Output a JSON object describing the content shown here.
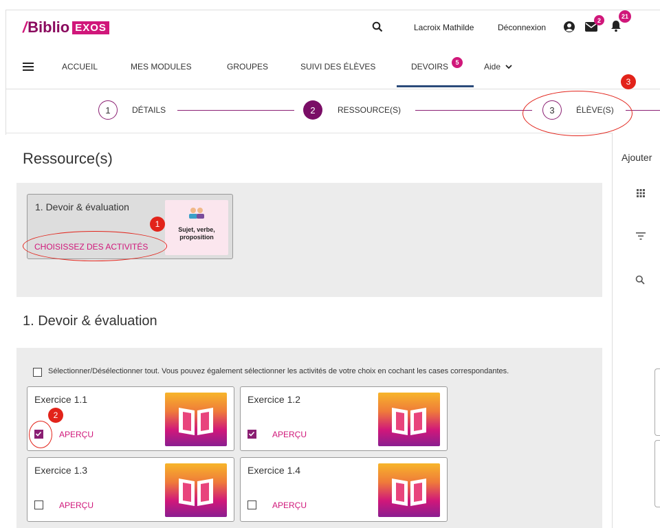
{
  "header": {
    "logo_prefix": "Biblio",
    "logo_suffix": "EXOS",
    "user_name": "Lacroix Mathilde",
    "logout_label": "Déconnexion",
    "mail_badge": "2",
    "notif_badge": "21"
  },
  "nav": {
    "items": [
      "ACCUEIL",
      "MES MODULES",
      "GROUPES",
      "SUIVI DES ÉLÈVES",
      "DEVOIRS",
      "Aide"
    ],
    "devoirs_badge": "5"
  },
  "stepper": {
    "steps": [
      {
        "number": "1",
        "label": "DÉTAILS"
      },
      {
        "number": "2",
        "label": "RESSOURCE(S)"
      },
      {
        "number": "3",
        "label": "ÉLÈVE(S)"
      }
    ]
  },
  "right_panel": {
    "title": "Ajouter"
  },
  "resources": {
    "title": "Ressource(s)",
    "card_title": "1. Devoir & évaluation",
    "choose_label": "CHOISISSEZ DES ACTIVITÉS",
    "thumb_text": "Sujet, verbe, proposition"
  },
  "section": {
    "title": "1. Devoir & évaluation",
    "select_all_label": "Sélectionner/Désélectionner tout. Vous pouvez également sélectionner les activités de votre choix en cochant les cases correspondantes.",
    "exercises": [
      {
        "title": "Exercice 1.1",
        "preview": "APERÇU",
        "checked": true
      },
      {
        "title": "Exercice 1.2",
        "preview": "APERÇU",
        "checked": true
      },
      {
        "title": "Exercice 1.3",
        "preview": "APERÇU",
        "checked": false
      },
      {
        "title": "Exercice 1.4",
        "preview": "APERÇU",
        "checked": false
      }
    ]
  },
  "annotations": [
    "1",
    "2",
    "3"
  ],
  "colors": {
    "brand": "#8a0a5e",
    "accent": "#d0177a",
    "annotation": "#e2231a",
    "nav_underline": "#2b4a7a"
  }
}
